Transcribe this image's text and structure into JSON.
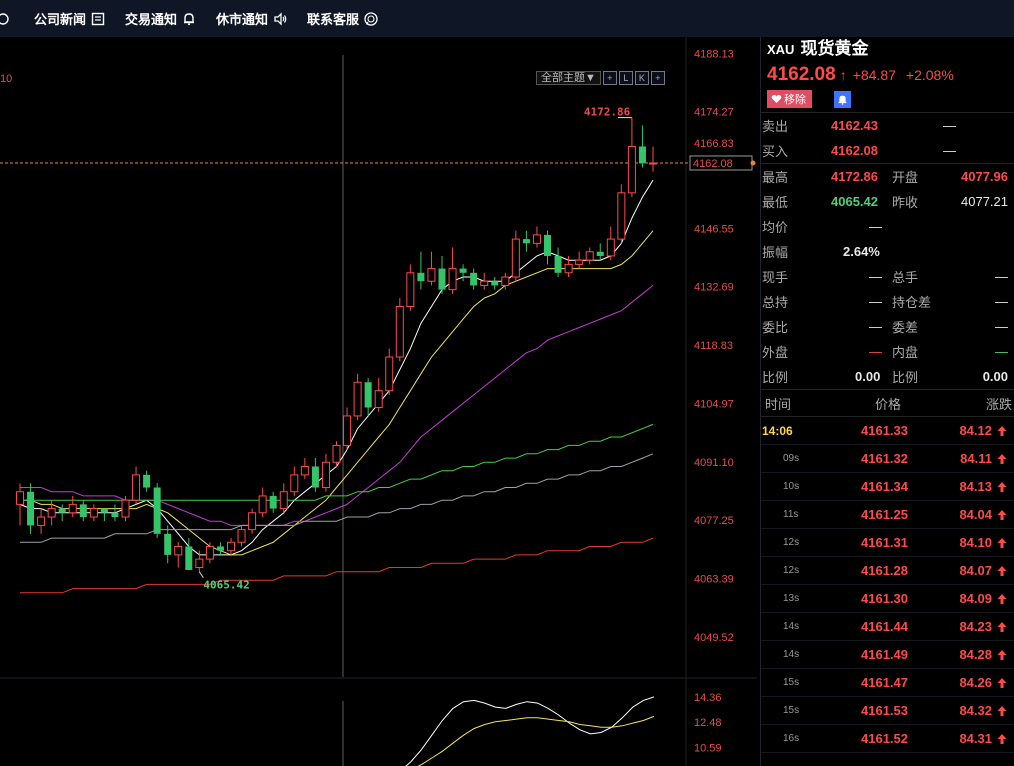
{
  "toolbar": {
    "items": [
      {
        "label": "公司新闻",
        "icon": "news-icon"
      },
      {
        "label": "交易通知",
        "icon": "bell-icon"
      },
      {
        "label": "休市通知",
        "icon": "speaker-icon"
      },
      {
        "label": "联系客服",
        "icon": "support-icon"
      }
    ]
  },
  "chart": {
    "corner_label": "10",
    "theme_label": "全部主题▼",
    "mini_buttons": [
      "+",
      "L",
      "K",
      "+"
    ],
    "price_axis": [
      "4188.13",
      "4174.27",
      "4166.83",
      "4162.08",
      "4146.55",
      "4132.69",
      "4118.83",
      "4104.97",
      "4091.10",
      "4077.25",
      "4063.39",
      "4049.52"
    ],
    "high_label": "4172.86",
    "low_label": "4065.42",
    "indicator_axis": [
      "14.36",
      "12.48",
      "10.59"
    ]
  },
  "chart_data": {
    "type": "candlestick",
    "ylim": [
      4040,
      4192
    ],
    "current_price": 4162.08,
    "candles": [
      [
        4081,
        4084,
        4076,
        4086
      ],
      [
        4084,
        4076,
        4074,
        4086
      ],
      [
        4076,
        4078,
        4074,
        4080
      ],
      [
        4078,
        4080,
        4076,
        4082
      ],
      [
        4080,
        4079,
        4077,
        4081
      ],
      [
        4079,
        4081,
        4078,
        4083
      ],
      [
        4081,
        4078,
        4077,
        4082
      ],
      [
        4078,
        4080,
        4077,
        4081
      ],
      [
        4080,
        4079,
        4077,
        4080
      ],
      [
        4079,
        4078,
        4077,
        4081
      ],
      [
        4078,
        4082,
        4077,
        4083
      ],
      [
        4082,
        4088,
        4081,
        4090
      ],
      [
        4088,
        4085,
        4084,
        4089
      ],
      [
        4085,
        4074,
        4073,
        4086
      ],
      [
        4074,
        4069,
        4067,
        4076
      ],
      [
        4069,
        4071,
        4066,
        4072
      ],
      [
        4071,
        4065.42,
        4065.42,
        4073
      ],
      [
        4066,
        4068,
        4065,
        4070
      ],
      [
        4068,
        4071,
        4067,
        4072
      ],
      [
        4071,
        4070,
        4069,
        4072
      ],
      [
        4070,
        4072,
        4069,
        4073
      ],
      [
        4072,
        4075,
        4071,
        4076
      ],
      [
        4075,
        4079,
        4074,
        4080
      ],
      [
        4079,
        4083,
        4078,
        4085
      ],
      [
        4083,
        4080,
        4079,
        4084
      ],
      [
        4080,
        4084,
        4079,
        4086
      ],
      [
        4084,
        4088,
        4083,
        4090
      ],
      [
        4088,
        4090,
        4087,
        4092
      ],
      [
        4090,
        4085,
        4084,
        4092
      ],
      [
        4085,
        4091,
        4084,
        4093
      ],
      [
        4091,
        4095,
        4090,
        4096
      ],
      [
        4095,
        4102,
        4094,
        4104
      ],
      [
        4102,
        4110,
        4101,
        4112
      ],
      [
        4110,
        4104,
        4102,
        4111
      ],
      [
        4104,
        4108,
        4103,
        4111
      ],
      [
        4108,
        4116,
        4107,
        4118
      ],
      [
        4116,
        4128,
        4115,
        4130
      ],
      [
        4128,
        4136,
        4127,
        4138
      ],
      [
        4136,
        4134,
        4132,
        4141
      ],
      [
        4134,
        4137,
        4133,
        4141
      ],
      [
        4137,
        4132,
        4131,
        4140
      ],
      [
        4132,
        4137,
        4131,
        4142
      ],
      [
        4137,
        4136,
        4134,
        4138
      ],
      [
        4136,
        4133,
        4132,
        4137
      ],
      [
        4133,
        4134,
        4132,
        4136
      ],
      [
        4134,
        4133,
        4132,
        4135
      ],
      [
        4133,
        4135,
        4132,
        4136
      ],
      [
        4135,
        4144,
        4134,
        4146
      ],
      [
        4144,
        4143,
        4141,
        4146
      ],
      [
        4143,
        4145,
        4142,
        4147
      ],
      [
        4145,
        4140,
        4138,
        4146
      ],
      [
        4140,
        4136,
        4135,
        4142
      ],
      [
        4136,
        4138,
        4135,
        4140
      ],
      [
        4138,
        4139,
        4137,
        4141
      ],
      [
        4139,
        4141,
        4138,
        4142
      ],
      [
        4141,
        4140,
        4139,
        4143
      ],
      [
        4140,
        4144,
        4139,
        4147
      ],
      [
        4144,
        4155,
        4143,
        4157
      ],
      [
        4155,
        4166,
        4154,
        4172.86
      ],
      [
        4166,
        4162,
        4161,
        4171
      ],
      [
        4162,
        4162.08,
        4160,
        4166
      ]
    ],
    "ma_lines": [
      {
        "color": "#ffffff",
        "values": [
          4081,
          4080,
          4080,
          4079,
          4079,
          4079,
          4079,
          4079,
          4079,
          4079,
          4080,
          4081,
          4082,
          4080,
          4077,
          4074,
          4071,
          4069,
          4069,
          4069,
          4069,
          4070,
          4072,
          4075,
          4077,
          4079,
          4082,
          4084,
          4086,
          4088,
          4090,
          4094,
          4099,
          4102,
          4105,
          4108,
          4113,
          4118,
          4124,
          4128,
          4132,
          4134,
          4135,
          4135,
          4134,
          4134,
          4134,
          4136,
          4138,
          4140,
          4141,
          4140,
          4139,
          4139,
          4139,
          4139,
          4140,
          4143,
          4149,
          4154,
          4158
        ]
      },
      {
        "color": "#f3e35a",
        "values": [
          4082,
          4082,
          4081,
          4081,
          4080,
          4080,
          4080,
          4080,
          4080,
          4080,
          4080,
          4080,
          4081,
          4080,
          4079,
          4077,
          4075,
          4073,
          4071,
          4070,
          4069,
          4069,
          4070,
          4071,
          4072,
          4074,
          4076,
          4078,
          4080,
          4082,
          4085,
          4088,
          4091,
          4094,
          4097,
          4100,
          4104,
          4108,
          4112,
          4116,
          4119,
          4122,
          4125,
          4128,
          4130,
          4131,
          4133,
          4134,
          4135,
          4136,
          4137,
          4137,
          4137,
          4137,
          4137,
          4137,
          4137,
          4138,
          4140,
          4143,
          4146
        ]
      },
      {
        "color": "#c43bd6",
        "values": [
          4085,
          4085,
          4085,
          4084,
          4084,
          4084,
          4083,
          4083,
          4083,
          4083,
          4082,
          4082,
          4082,
          4082,
          4081,
          4080,
          4079,
          4078,
          4077,
          4077,
          4076,
          4076,
          4076,
          4076,
          4076,
          4076,
          4077,
          4077,
          4078,
          4079,
          4080,
          4081,
          4083,
          4085,
          4087,
          4089,
          4091,
          4094,
          4097,
          4099,
          4101,
          4103,
          4105,
          4107,
          4109,
          4111,
          4113,
          4115,
          4117,
          4118,
          4120,
          4121,
          4122,
          4123,
          4124,
          4125,
          4126,
          4127,
          4129,
          4131,
          4133
        ]
      },
      {
        "color": "#3fcf3f",
        "values": [
          4082,
          4082,
          4082,
          4082,
          4082,
          4082,
          4082,
          4082,
          4082,
          4082,
          4082,
          4082,
          4082,
          4082,
          4082,
          4082,
          4082,
          4082,
          4082,
          4082,
          4082,
          4082,
          4082,
          4082,
          4082,
          4082,
          4082,
          4082,
          4082,
          4083,
          4083,
          4083,
          4084,
          4084,
          4085,
          4085,
          4086,
          4087,
          4087,
          4088,
          4089,
          4089,
          4090,
          4090,
          4091,
          4091,
          4092,
          4092,
          4093,
          4093,
          4094,
          4094,
          4095,
          4095,
          4096,
          4096,
          4097,
          4097,
          4098,
          4099,
          4100
        ]
      },
      {
        "color": "#9aa3a8",
        "values": [
          4072,
          4072,
          4072,
          4073,
          4073,
          4073,
          4073,
          4073,
          4073,
          4074,
          4074,
          4074,
          4074,
          4075,
          4075,
          4075,
          4075,
          4075,
          4075,
          4075,
          4075,
          4076,
          4076,
          4076,
          4076,
          4076,
          4076,
          4077,
          4077,
          4077,
          4077,
          4078,
          4078,
          4078,
          4079,
          4079,
          4080,
          4080,
          4081,
          4081,
          4082,
          4082,
          4083,
          4083,
          4084,
          4084,
          4085,
          4085,
          4086,
          4086,
          4087,
          4087,
          4088,
          4088,
          4089,
          4089,
          4090,
          4090,
          4091,
          4092,
          4093
        ]
      },
      {
        "color": "#e23a2a",
        "values": [
          4060,
          4060,
          4060,
          4060,
          4060,
          4061,
          4061,
          4061,
          4061,
          4061,
          4061,
          4061,
          4062,
          4062,
          4062,
          4062,
          4062,
          4062,
          4062,
          4063,
          4063,
          4063,
          4063,
          4063,
          4063,
          4064,
          4064,
          4064,
          4064,
          4064,
          4065,
          4065,
          4065,
          4065,
          4065,
          4066,
          4066,
          4066,
          4066,
          4067,
          4067,
          4067,
          4067,
          4068,
          4068,
          4068,
          4068,
          4069,
          4069,
          4069,
          4070,
          4070,
          4070,
          4070,
          4071,
          4071,
          4071,
          4072,
          4072,
          4072,
          4073
        ]
      }
    ],
    "indicator": {
      "ylim": [
        9.2,
        14.8
      ],
      "lines": [
        {
          "color": "#ffffff",
          "values": [
            8.8,
            9.5,
            10.4,
            11.5,
            12.6,
            13.5,
            14.0,
            14.1,
            13.9,
            13.6,
            13.5,
            13.8,
            14.0,
            13.9,
            13.5,
            13.0,
            12.4,
            11.9,
            11.6,
            11.7,
            12.1,
            12.8,
            13.6,
            14.1,
            14.36
          ]
        },
        {
          "color": "#f3e35a",
          "values": [
            8.6,
            8.9,
            9.3,
            9.8,
            10.3,
            10.9,
            11.5,
            12.0,
            12.3,
            12.5,
            12.6,
            12.7,
            12.8,
            12.8,
            12.7,
            12.6,
            12.5,
            12.3,
            12.2,
            12.1,
            12.1,
            12.2,
            12.4,
            12.6,
            12.9
          ]
        }
      ]
    }
  },
  "quote": {
    "code": "XAU",
    "name": "现货黄金",
    "price": "4162.08",
    "change": "+84.87",
    "percent": "+2.08%",
    "remove_label": "移除",
    "sell_label": "卖出",
    "sell_price": "4162.43",
    "sell_vol": "—",
    "buy_label": "买入",
    "buy_price": "4162.08",
    "buy_vol": "—",
    "high_label": "最高",
    "high": "4172.86",
    "open_label": "开盘",
    "open": "4077.96",
    "low_label": "最低",
    "low": "4065.42",
    "prev_label": "昨收",
    "prev": "4077.21",
    "avg_label": "均价",
    "avg": "—",
    "amp_label": "振幅",
    "amp": "2.64%",
    "cur_label": "现手",
    "cur": "—",
    "total_label": "总手",
    "total": "—",
    "hold_label": "总持",
    "hold": "—",
    "hold_diff_label": "持仓差",
    "hold_diff": "—",
    "ratio_label": "委比",
    "ratio": "—",
    "diff_label": "委差",
    "diff": "—",
    "outer_label": "外盘",
    "outer": "—",
    "inner_label": "内盘",
    "inner": "—",
    "prop_label": "比例",
    "prop": "0.00",
    "prop2_label": "比例",
    "prop2": "0.00"
  },
  "ticks": {
    "headers": {
      "time": "时间",
      "price": "价格",
      "change": "涨跌"
    },
    "rows": [
      {
        "time": "14:06",
        "price": "4161.33",
        "change": "84.12"
      },
      {
        "time": "09s",
        "price": "4161.32",
        "change": "84.11"
      },
      {
        "time": "10s",
        "price": "4161.34",
        "change": "84.13"
      },
      {
        "time": "11s",
        "price": "4161.25",
        "change": "84.04"
      },
      {
        "time": "12s",
        "price": "4161.31",
        "change": "84.10"
      },
      {
        "time": "12s",
        "price": "4161.28",
        "change": "84.07"
      },
      {
        "time": "13s",
        "price": "4161.30",
        "change": "84.09"
      },
      {
        "time": "14s",
        "price": "4161.44",
        "change": "84.23"
      },
      {
        "time": "14s",
        "price": "4161.49",
        "change": "84.28"
      },
      {
        "time": "15s",
        "price": "4161.47",
        "change": "84.26"
      },
      {
        "time": "15s",
        "price": "4161.53",
        "change": "84.32"
      },
      {
        "time": "16s",
        "price": "4161.52",
        "change": "84.31"
      }
    ]
  },
  "colors": {
    "up": "#ff4a4a",
    "down": "#35c46a",
    "bg": "#000000",
    "toolbar": "#0f1626"
  }
}
